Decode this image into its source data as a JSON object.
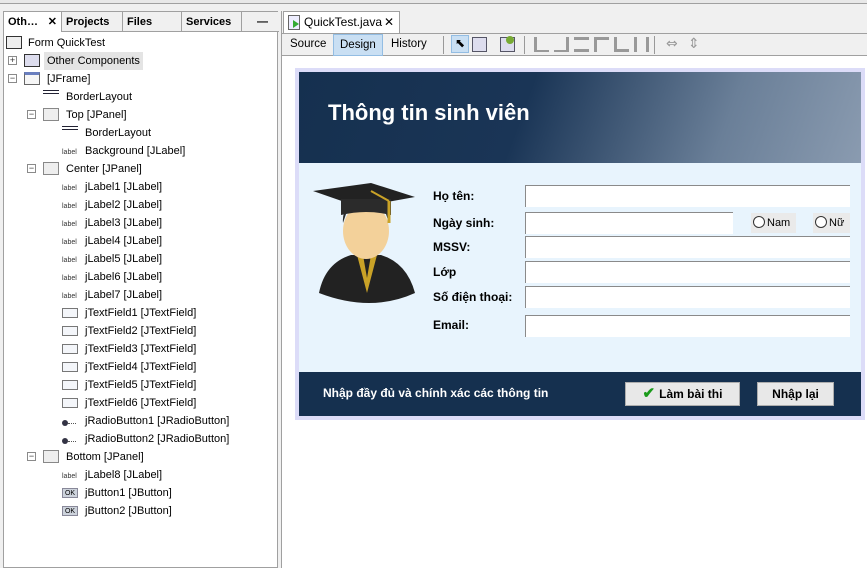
{
  "left_panel": {
    "tabs": [
      "Oth…",
      "Projects",
      "Files",
      "Services"
    ],
    "tree": [
      {
        "label": "Form QuickTest",
        "level": 0,
        "icon": "form-icon"
      },
      {
        "label": "Other Components",
        "level": 0,
        "expander": "+",
        "icon": "components-icon",
        "highlight": true
      },
      {
        "label": "[JFrame]",
        "level": 0,
        "expander": "-",
        "icon": "frame-icon"
      },
      {
        "label": "BorderLayout",
        "level": 1,
        "icon": "layout-icon"
      },
      {
        "label": "Top [JPanel]",
        "level": 1,
        "expander": "-",
        "icon": "panel-icon"
      },
      {
        "label": "BorderLayout",
        "level": 2,
        "icon": "layout-icon"
      },
      {
        "label": "Background [JLabel]",
        "level": 2,
        "icon": "label-icon"
      },
      {
        "label": "Center [JPanel]",
        "level": 1,
        "expander": "-",
        "icon": "panel-icon"
      },
      {
        "label": "jLabel1 [JLabel]",
        "level": 2,
        "icon": "label-icon"
      },
      {
        "label": "jLabel2 [JLabel]",
        "level": 2,
        "icon": "label-icon"
      },
      {
        "label": "jLabel3 [JLabel]",
        "level": 2,
        "icon": "label-icon"
      },
      {
        "label": "jLabel4 [JLabel]",
        "level": 2,
        "icon": "label-icon"
      },
      {
        "label": "jLabel5 [JLabel]",
        "level": 2,
        "icon": "label-icon"
      },
      {
        "label": "jLabel6 [JLabel]",
        "level": 2,
        "icon": "label-icon"
      },
      {
        "label": "jLabel7 [JLabel]",
        "level": 2,
        "icon": "label-icon"
      },
      {
        "label": "jTextField1 [JTextField]",
        "level": 2,
        "icon": "textfield-icon"
      },
      {
        "label": "jTextField2 [JTextField]",
        "level": 2,
        "icon": "textfield-icon"
      },
      {
        "label": "jTextField3 [JTextField]",
        "level": 2,
        "icon": "textfield-icon"
      },
      {
        "label": "jTextField4 [JTextField]",
        "level": 2,
        "icon": "textfield-icon"
      },
      {
        "label": "jTextField5 [JTextField]",
        "level": 2,
        "icon": "textfield-icon"
      },
      {
        "label": "jTextField6 [JTextField]",
        "level": 2,
        "icon": "textfield-icon"
      },
      {
        "label": "jRadioButton1 [JRadioButton]",
        "level": 2,
        "icon": "radio-icon"
      },
      {
        "label": "jRadioButton2 [JRadioButton]",
        "level": 2,
        "icon": "radio-icon"
      },
      {
        "label": "Bottom [JPanel]",
        "level": 1,
        "expander": "-",
        "icon": "panel-icon"
      },
      {
        "label": "jLabel8 [JLabel]",
        "level": 2,
        "icon": "label-icon"
      },
      {
        "label": "jButton1 [JButton]",
        "level": 2,
        "icon": "button-icon"
      },
      {
        "label": "jButton2 [JButton]",
        "level": 2,
        "icon": "button-icon"
      }
    ]
  },
  "editor": {
    "tab_label": "QuickTest.java",
    "views": [
      "Source",
      "Design",
      "History"
    ],
    "active_view": "Design"
  },
  "form": {
    "title": "Thông tin sinh viên",
    "labels": [
      "Họ tên:",
      "Ngày sinh:",
      "MSSV:",
      "Lớp",
      "Số điện thoại:",
      "Email:"
    ],
    "radio_male": "Nam",
    "radio_female": "Nữ",
    "footer_msg": "Nhập đầy đủ và chính xác các thông tin",
    "submit_label": "Làm bài thi",
    "reset_label": "Nhập lại",
    "colors": {
      "header": "#15304f",
      "body": "#e8f4fd"
    }
  }
}
